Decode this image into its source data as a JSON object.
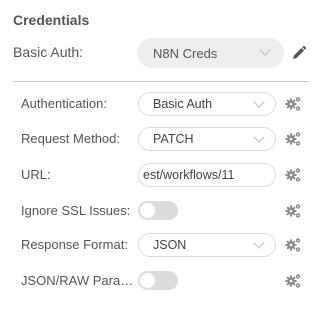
{
  "section": {
    "title": "Credentials"
  },
  "credentials": {
    "label": "Basic Auth:",
    "selected": "N8N Creds",
    "edit_icon": "pencil-icon"
  },
  "params": [
    {
      "label": "Authentication:",
      "type": "select",
      "value": "Basic Auth",
      "icon": "cogs-icon"
    },
    {
      "label": "Request Method:",
      "type": "select",
      "value": "PATCH",
      "icon": "cogs-icon"
    },
    {
      "label": "URL:",
      "type": "text",
      "value": "est/workflows/11",
      "icon": "cogs-icon"
    },
    {
      "label": "Ignore SSL Issues:",
      "type": "toggle",
      "value": "off",
      "icon": "cogs-icon"
    },
    {
      "label": "Response Format:",
      "type": "select",
      "value": "JSON",
      "icon": "cogs-icon"
    },
    {
      "label": "JSON/RAW Parameters:",
      "type": "toggle",
      "value": "off",
      "icon": "cogs-icon"
    }
  ],
  "colors": {
    "text": "#555555",
    "select_bg": "#eeeeee",
    "toggle_off": "#dcdcdc",
    "icon": "#8a8a8a"
  }
}
